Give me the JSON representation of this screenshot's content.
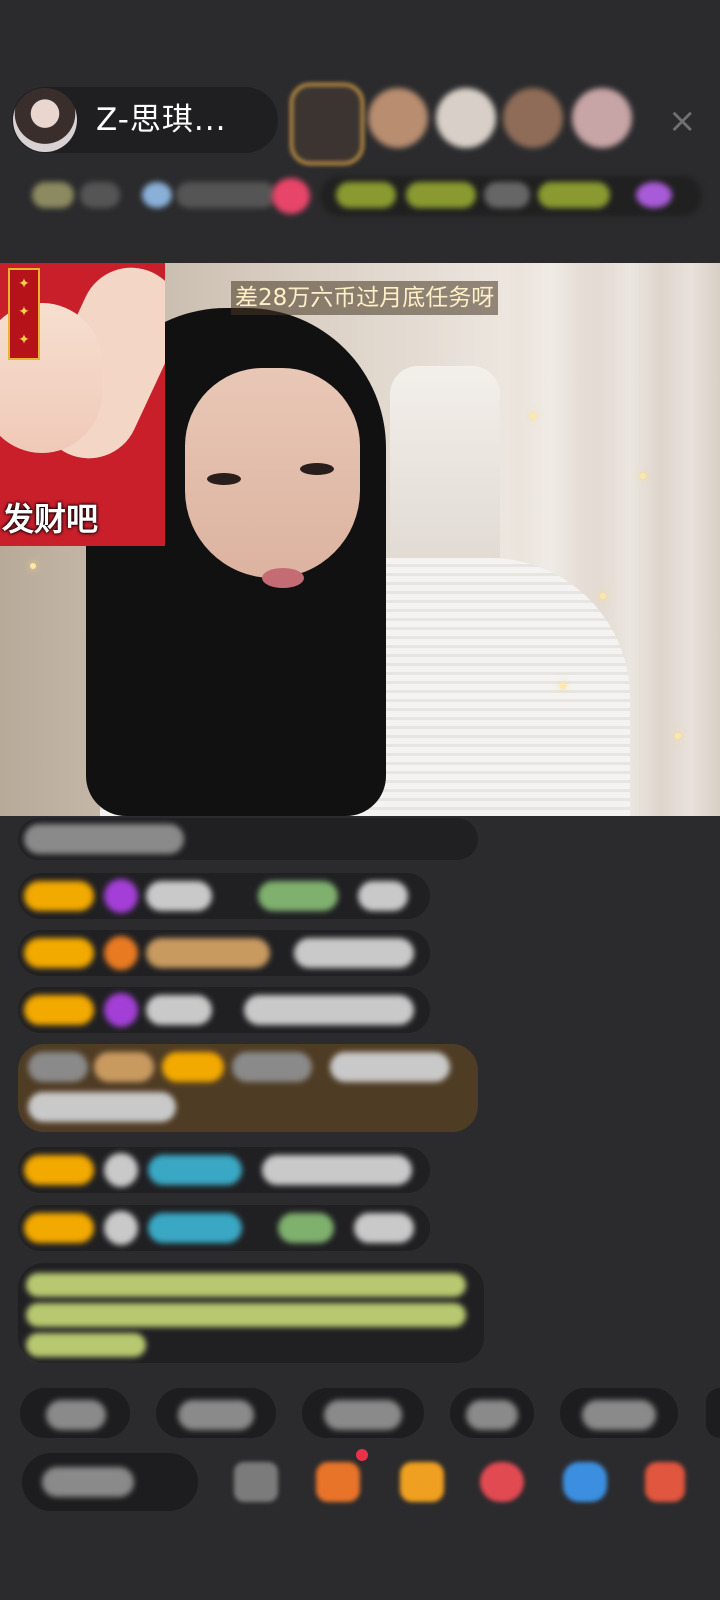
{
  "host": {
    "name": "Z-思琪..."
  },
  "header": {
    "close_label": "×"
  },
  "stream": {
    "caption": "差28万六币过月底任务呀",
    "sticker_text": "发财吧"
  },
  "colors": {
    "background": "#2b2b2d",
    "pill": "#1d1d1f",
    "badge_gold": "#f2a900",
    "sticker_red": "#c81f2b",
    "caption_text": "#fff0c8"
  },
  "icons": [
    "host-avatar",
    "close-icon",
    "gift-icon",
    "box-icon",
    "game-icon",
    "shop-icon",
    "more-icon"
  ]
}
